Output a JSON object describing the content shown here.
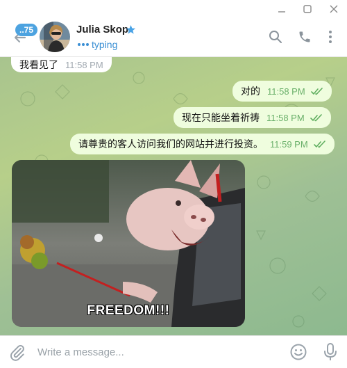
{
  "window": {
    "controls": [
      "minimize",
      "maximize",
      "close"
    ]
  },
  "header": {
    "unread_badge": "..75",
    "contact_name": "Julia Skop",
    "status": "typing",
    "icons": [
      "back-arrow-icon",
      "verified-star-icon",
      "search-icon",
      "phone-icon",
      "more-vertical-icon"
    ]
  },
  "colors": {
    "accent": "#3a8fd4",
    "badge": "#4da3e0",
    "outgoing_bubble": "#effdde",
    "incoming_bubble": "#ffffff",
    "check": "#6ab06a"
  },
  "messages": [
    {
      "direction": "in",
      "text": "我看见了",
      "time": "11:58 PM"
    },
    {
      "direction": "out",
      "text": "对的",
      "time": "11:58 PM",
      "read": true
    },
    {
      "direction": "out",
      "text": "现在只能坐着祈祷",
      "time": "11:58 PM",
      "read": true
    },
    {
      "direction": "out",
      "text": "请尊贵的客人访问我们的网站并进行投资。",
      "time": "11:59 PM",
      "read": true
    }
  ],
  "gif": {
    "caption": "FREEDOM!!!"
  },
  "composer": {
    "placeholder": "Write a message...",
    "icons": [
      "paperclip-icon",
      "emoji-icon",
      "microphone-icon"
    ]
  }
}
